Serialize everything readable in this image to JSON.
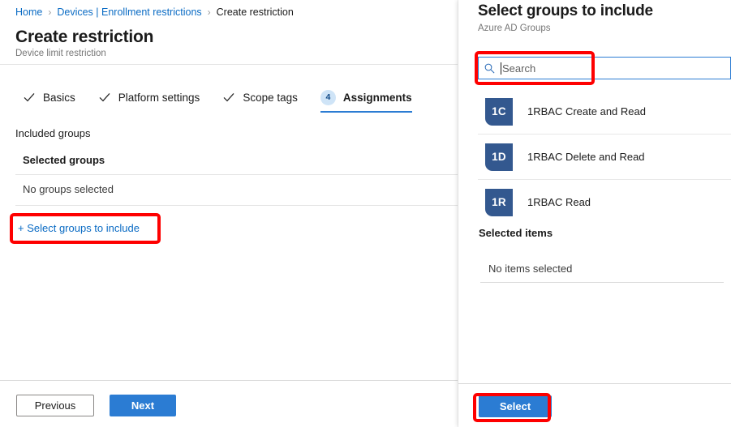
{
  "breadcrumb": {
    "separator": "›",
    "items": [
      {
        "label": "Home",
        "type": "link"
      },
      {
        "label": "Devices | Enrollment restrictions",
        "type": "link"
      },
      {
        "label": "Create restriction",
        "type": "current"
      }
    ]
  },
  "left_blade": {
    "title": "Create restriction",
    "subtitle": "Device limit restriction",
    "tabs": [
      {
        "label": "Basics",
        "state": "complete",
        "icon": "check-icon"
      },
      {
        "label": "Platform settings",
        "state": "complete",
        "icon": "check-icon"
      },
      {
        "label": "Scope tags",
        "state": "complete",
        "icon": "check-icon"
      },
      {
        "label": "Assignments",
        "state": "active",
        "badge": "4"
      }
    ],
    "section_label": "Included groups",
    "grid": {
      "header": "Selected groups",
      "empty_row": "No groups selected"
    },
    "add_link": "+ Select groups to include",
    "footer": {
      "previous_label": "Previous",
      "next_label": "Next"
    }
  },
  "right_blade": {
    "title": "Select groups to include",
    "subtitle": "Azure AD Groups",
    "search": {
      "placeholder": "Search",
      "value": "",
      "icon": "search-icon"
    },
    "groups": [
      {
        "initials": "1C",
        "name": "1RBAC Create and Read"
      },
      {
        "initials": "1D",
        "name": "1RBAC Delete and Read"
      },
      {
        "initials": "1R",
        "name": "1RBAC Read"
      }
    ],
    "selected_items": {
      "heading": "Selected items",
      "empty": "No items selected"
    },
    "footer": {
      "select_label": "Select"
    }
  },
  "colors": {
    "accent_blue": "#2b7cd3",
    "link_blue": "#0a6bc4",
    "avatar_blue": "#33588f",
    "badge_bg": "#cfe4f7",
    "annotation_red": "#fe0000"
  }
}
